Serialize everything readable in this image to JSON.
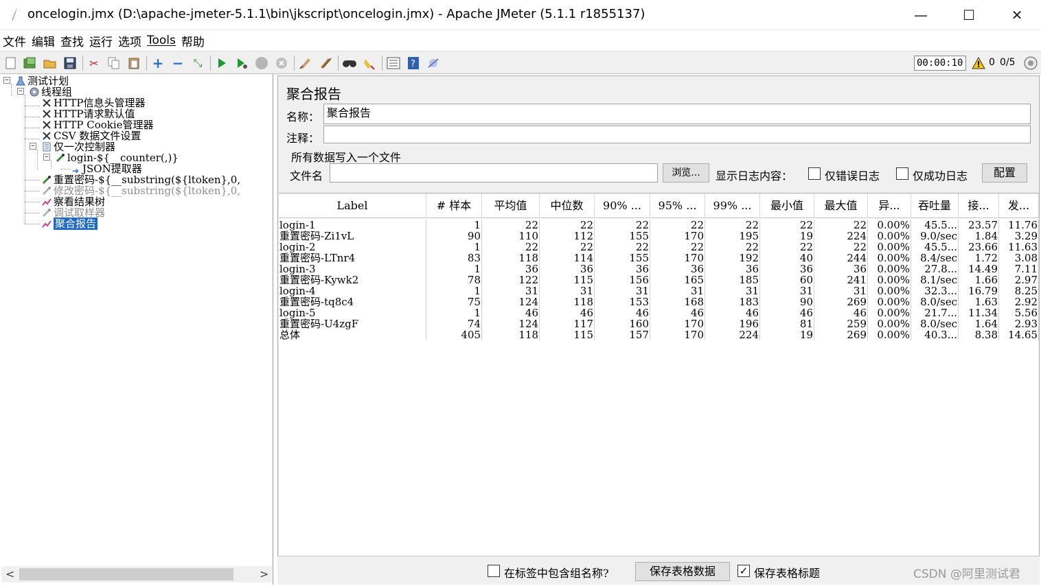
{
  "window": {
    "title": "oncelogin.jmx (D:\\apache-jmeter-5.1.1\\bin\\jkscript\\oncelogin.jmx) - Apache JMeter (5.1.1 r1855137)",
    "minimize": "—",
    "maximize": "☐",
    "close": "✕"
  },
  "menu": [
    "文件",
    "编辑",
    "查找",
    "运行",
    "选项",
    "Tools",
    "帮助"
  ],
  "toolbar": {
    "timer": "00:00:10",
    "warning_count": "0",
    "threads": "0/5"
  },
  "tree": {
    "test_plan": "测试计划",
    "thread_group": "线程组",
    "header_manager": "HTTP信息头管理器",
    "request_defaults": "HTTP请求默认值",
    "cookie_manager": "HTTP Cookie管理器",
    "csv_config": "CSV 数据文件设置",
    "once_only": "仅一次控制器",
    "login_sampler": "login-${__counter(,)}",
    "json_extractor": "JSON提取器",
    "reset_pwd": "重置密码-${__substring(${ltoken},0,",
    "modify_pwd": "修改密码-${__substring(${ltoken},0,",
    "view_tree": "察看结果树",
    "debug_sampler": "调试取样器",
    "aggregate": "聚合报告"
  },
  "panel": {
    "title": "聚合报告",
    "name_label": "名称：",
    "name_value": "聚合报告",
    "comment_label": "注释：",
    "comment_value": "",
    "file_group_title": "所有数据写入一个文件",
    "filename_label": "文件名",
    "filename_value": "",
    "browse_button": "浏览...",
    "log_label": "显示日志内容：",
    "errors_only": "仅错误日志",
    "success_only": "仅成功日志",
    "configure_button": "配置"
  },
  "table": {
    "headers": [
      "Label",
      "# 样本",
      "平均值",
      "中位数",
      "90% ...",
      "95% ...",
      "99% ...",
      "最小值",
      "最大值",
      "异...",
      "吞吐量",
      "接...",
      "发..."
    ],
    "rows": [
      [
        "login-1",
        "1",
        "22",
        "22",
        "22",
        "22",
        "22",
        "22",
        "22",
        "0.00%",
        "45.5...",
        "23.57",
        "11.76"
      ],
      [
        "重置密码-Zi1vL",
        "90",
        "110",
        "112",
        "155",
        "170",
        "195",
        "19",
        "224",
        "0.00%",
        "9.0/sec",
        "1.84",
        "3.29"
      ],
      [
        "login-2",
        "1",
        "22",
        "22",
        "22",
        "22",
        "22",
        "22",
        "22",
        "0.00%",
        "45.5...",
        "23.66",
        "11.63"
      ],
      [
        "重置密码-LTnr4",
        "83",
        "118",
        "114",
        "155",
        "170",
        "192",
        "40",
        "244",
        "0.00%",
        "8.4/sec",
        "1.72",
        "3.08"
      ],
      [
        "login-3",
        "1",
        "36",
        "36",
        "36",
        "36",
        "36",
        "36",
        "36",
        "0.00%",
        "27.8...",
        "14.49",
        "7.11"
      ],
      [
        "重置密码-Kywk2",
        "78",
        "122",
        "115",
        "156",
        "165",
        "185",
        "60",
        "241",
        "0.00%",
        "8.1/sec",
        "1.66",
        "2.97"
      ],
      [
        "login-4",
        "1",
        "31",
        "31",
        "31",
        "31",
        "31",
        "31",
        "31",
        "0.00%",
        "32.3...",
        "16.79",
        "8.25"
      ],
      [
        "重置密码-tq8c4",
        "75",
        "124",
        "118",
        "153",
        "168",
        "183",
        "90",
        "269",
        "0.00%",
        "8.0/sec",
        "1.63",
        "2.92"
      ],
      [
        "login-5",
        "1",
        "46",
        "46",
        "46",
        "46",
        "46",
        "46",
        "46",
        "0.00%",
        "21.7...",
        "11.34",
        "5.56"
      ],
      [
        "重置密码-U4zgF",
        "74",
        "124",
        "117",
        "160",
        "170",
        "196",
        "81",
        "259",
        "0.00%",
        "8.0/sec",
        "1.64",
        "2.93"
      ],
      [
        "总体",
        "405",
        "118",
        "115",
        "157",
        "170",
        "224",
        "19",
        "269",
        "0.00%",
        "40.3...",
        "8.38",
        "14.65"
      ]
    ]
  },
  "bottom": {
    "include_group": "在标签中包含组名称?",
    "save_table": "保存表格数据",
    "save_header": "保存表格标题"
  },
  "watermark": "CSDN @阿里测试君"
}
